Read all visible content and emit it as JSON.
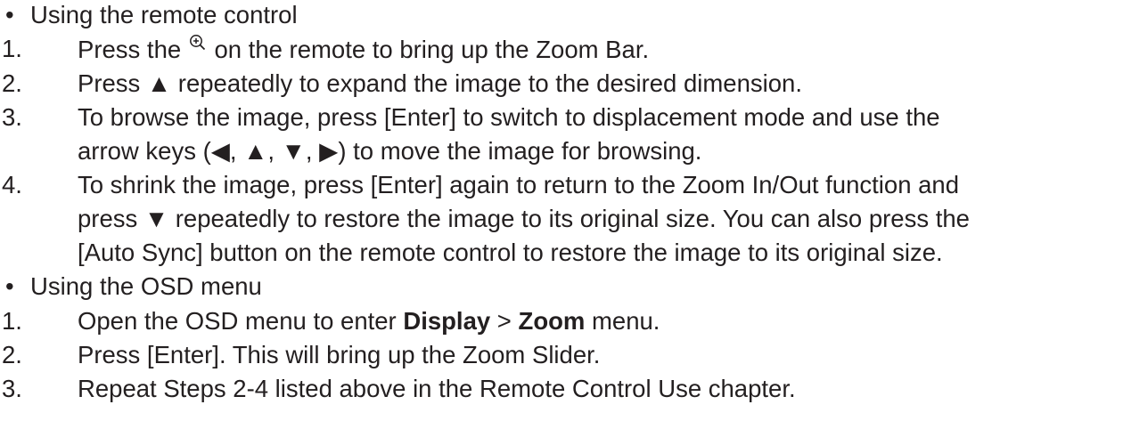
{
  "bullet_char": "•",
  "sections": [
    {
      "heading": "Using the remote control",
      "steps": [
        {
          "num": "1.",
          "pre": "Press the ",
          "icon": "zoom-in-icon",
          "post": " on the remote to bring up the Zoom Bar."
        },
        {
          "num": "2.",
          "text": "Press ▲ repeatedly to expand the image to the desired dimension."
        },
        {
          "num": "3.",
          "lines": [
            "To browse the image, press [Enter] to switch to displacement mode and use the",
            "arrow keys (◀, ▲, ▼, ▶) to move the image for browsing."
          ]
        },
        {
          "num": "4.",
          "lines": [
            "To shrink the image, press [Enter] again to return to the Zoom In/Out function and",
            "press ▼ repeatedly to restore the image to its original size. You can also press the",
            "[Auto Sync] button on the remote control to restore the image to its original size."
          ]
        }
      ]
    },
    {
      "heading": "Using the OSD menu",
      "steps": [
        {
          "num": "1.",
          "pre": "Open the OSD menu to enter ",
          "bold1": "Display",
          "mid": " > ",
          "bold2": "Zoom",
          "post": " menu."
        },
        {
          "num": "2.",
          "text": "Press [Enter]. This will bring up the Zoom Slider."
        },
        {
          "num": "3.",
          "text": "Repeat Steps 2-4 listed above in the Remote Control Use chapter."
        }
      ]
    }
  ]
}
